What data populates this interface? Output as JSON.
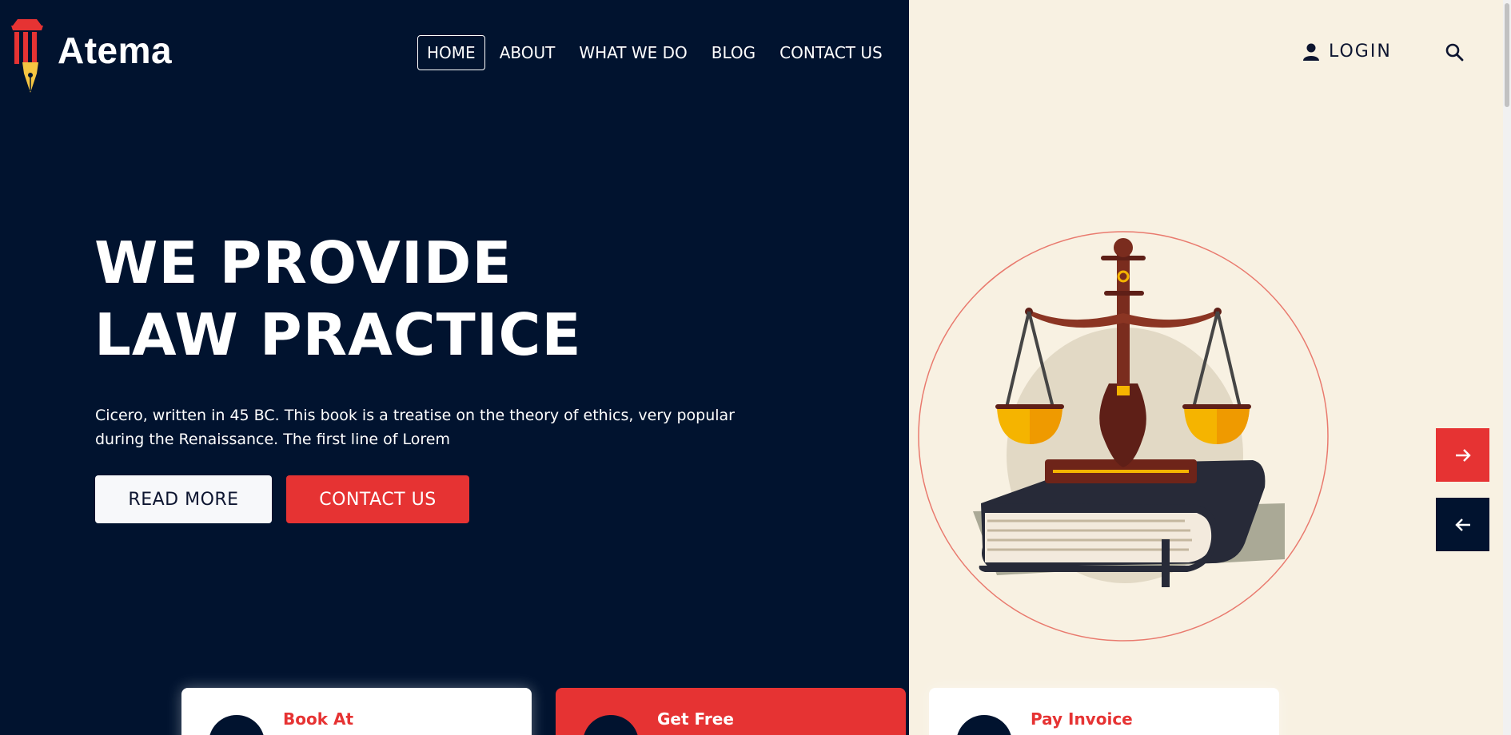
{
  "brand": {
    "name": "Atema"
  },
  "nav": {
    "items": [
      {
        "label": "HOME",
        "active": true
      },
      {
        "label": "ABOUT",
        "active": false
      },
      {
        "label": "WHAT WE DO",
        "active": false
      },
      {
        "label": "BLOG",
        "active": false
      },
      {
        "label": "CONTACT US",
        "active": false
      }
    ]
  },
  "header": {
    "login_label": "LOGIN",
    "login_icon": "user-icon",
    "search_icon": "search-icon"
  },
  "hero": {
    "title_line1": "WE PROVIDE",
    "title_line2": "LAW PRACTICE",
    "description": "Cicero, written in 45 BC. This book is a treatise on the theory of ethics, very popular during the Renaissance. The first line of Lorem",
    "read_more_label": "READ MORE",
    "contact_label": "CONTACT US"
  },
  "slider": {
    "next_icon": "arrow-right-icon",
    "prev_icon": "arrow-left-icon"
  },
  "cards": [
    {
      "label": "Book At",
      "style": "white"
    },
    {
      "label": "Get Free",
      "style": "red"
    },
    {
      "label": "Pay Invoice",
      "style": "white"
    }
  ],
  "colors": {
    "navy": "#01132f",
    "accent_red": "#e63333",
    "cream": "#f8f1e2"
  }
}
